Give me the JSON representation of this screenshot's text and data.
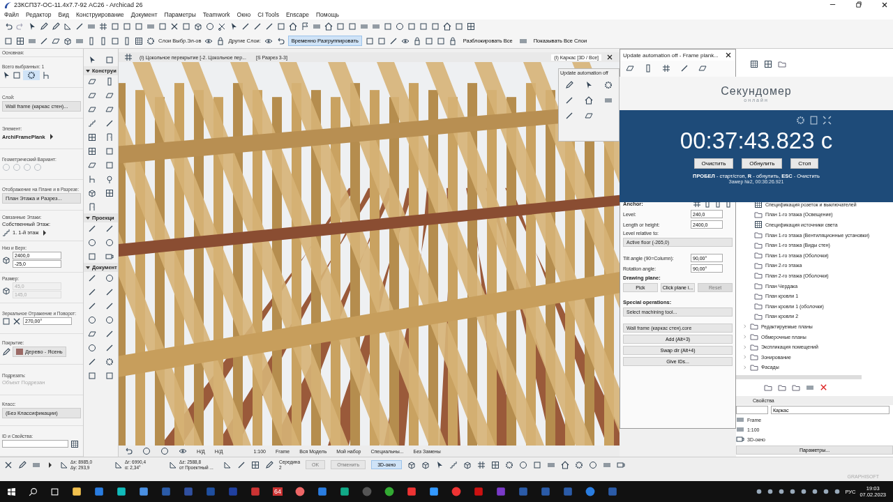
{
  "window": {
    "title": "23КСП37-ОС-11.4х7.7-92  AC26 - Archicad 26"
  },
  "menu": [
    "Файл",
    "Редактор",
    "Вид",
    "Конструирование",
    "Документ",
    "Параметры",
    "Teamwork",
    "Окно",
    "CI Tools",
    "Enscape",
    "Помощь"
  ],
  "toolbar": {
    "layer_labels": [
      "Слои Выбр.Эл-ов",
      "Другие Слои:"
    ],
    "buttons": [
      {
        "label": "Временно Разгруппировать",
        "selected": true
      },
      {
        "label": "Разблокировать Все",
        "selected": false
      },
      {
        "label": "Показывать Все Слои",
        "selected": false
      }
    ]
  },
  "info_panel": [
    {
      "kind": "header",
      "label": "Основная:"
    },
    {
      "kind": "selection",
      "label": "Всего выбранных: 1"
    },
    {
      "kind": "dropdown",
      "label": "Слой:",
      "value": "Wall frame (каркас стен)..."
    },
    {
      "kind": "element",
      "label": "Элемент:",
      "value": "ArchiFramePlank"
    },
    {
      "kind": "variants",
      "label": "Геометрический Вариант:"
    },
    {
      "kind": "dropdown",
      "label": "Отображение на Плане и в Разрезе:",
      "value": "План Этажа и Разрез..."
    },
    {
      "kind": "story",
      "label": "Связанные Этажи:",
      "title": "Собственный Этаж:",
      "value": "1. 1-й этаж"
    },
    {
      "kind": "pair",
      "label": "Низ и Верх:",
      "values": [
        "2400,0",
        "-25,0"
      ],
      "disabled": false
    },
    {
      "kind": "pair",
      "label": "Размер:",
      "values": [
        "45,0",
        "145,0"
      ],
      "disabled": true
    },
    {
      "kind": "angle",
      "label": "Зеркальное Отражение и Поворот:",
      "value": "270,00°"
    },
    {
      "kind": "surface",
      "label": "Покрытие:",
      "value": "Дерево - Ясень"
    },
    {
      "kind": "toggle",
      "label": "Подрезать:",
      "value": "Объект Подрезан",
      "disabled": true
    },
    {
      "kind": "dropdown",
      "label": "Класс:",
      "value": "(Без Классификации)"
    },
    {
      "kind": "field",
      "label": "ID и Свойства:"
    }
  ],
  "toolbox": [
    {
      "label": "Конструи",
      "expanded": true
    },
    {
      "label": "Проекци",
      "expanded": true
    },
    {
      "label": "Документ",
      "expanded": true
    }
  ],
  "view_tabs": [
    {
      "label": "(I) Цокольное перекрытие [-2. Цокольное пер...",
      "selected": false
    },
    {
      "label": "[S Разрез 3-3]",
      "selected": false
    },
    {
      "label": "(I) Каркас [3D / Все]",
      "selected": true
    }
  ],
  "view_bar": [
    "Н/Д",
    "Н/Д",
    "1:100",
    "Frame",
    "Вся Модель",
    "Мой набор",
    "Специальны...",
    "Без Замены"
  ],
  "mini_palette": {
    "title": "Update automation off"
  },
  "frame_palette": {
    "title": "Update automation off - Frame plank...",
    "anchor_label": "Anchor:",
    "fields": [
      {
        "label": "Level:",
        "value": "240,0"
      },
      {
        "label": "Length or height:",
        "value": "2400,0"
      }
    ],
    "level_relative": {
      "label": "Level relative to:",
      "value": "Active floor (-265,0)"
    },
    "angles": [
      {
        "label": "Tilt angle (90=Column):",
        "value": "90,00°"
      },
      {
        "label": "Rotation angle:",
        "value": "90,00°"
      }
    ],
    "drawing_plane": {
      "label": "Drawing plane:",
      "buttons": [
        {
          "label": "Pick",
          "disabled": false
        },
        {
          "label": "Click plane i...",
          "disabled": false
        },
        {
          "label": "Reset",
          "disabled": true
        }
      ]
    },
    "special": {
      "label": "Special operations:",
      "value": "Select machining tool..."
    },
    "layer": "Wall frame (каркас стен).core",
    "actions": [
      "Add (Alt+3)",
      "Swap dir (Alt+4)",
      "Give IDs..."
    ]
  },
  "stopwatch": {
    "title": "Секундомер",
    "subtitle": "онлайн",
    "time": "00:37:43.823 с",
    "buttons": [
      "Очистить",
      "Обнулить",
      "Стоп"
    ],
    "hint": "**ПРОБЕЛ** - старт/стоп, **R** - обнулить, **ESC** - Очистить",
    "lap": "Замер №2, 00:36:26.921"
  },
  "navigator": {
    "items": [
      {
        "kind": "schedule",
        "label": "Спецификация розеток и выключателей"
      },
      {
        "kind": "view",
        "label": "План 1-го этажа (Освещение)"
      },
      {
        "kind": "schedule",
        "label": "Спецификация источники света"
      },
      {
        "kind": "view",
        "label": "План 1-го этажа (Вентиляционные установки)"
      },
      {
        "kind": "view",
        "label": "План 1-го этажа (Виды стен)"
      },
      {
        "kind": "view",
        "label": "План 1-го этажа (Оболочки)"
      },
      {
        "kind": "view",
        "label": "План 2-го этажа"
      },
      {
        "kind": "view",
        "label": "План 2-го этажа (Оболочки)"
      },
      {
        "kind": "view",
        "label": "План Чердака"
      },
      {
        "kind": "view",
        "label": "План кровли 1"
      },
      {
        "kind": "view",
        "label": "План кровли 1 (оболочки)"
      },
      {
        "kind": "view",
        "label": "План кровли 2"
      },
      {
        "kind": "folder",
        "label": "Редактируемые планы"
      },
      {
        "kind": "folder",
        "label": "Обмерочные планы"
      },
      {
        "kind": "folder",
        "label": "Экспликация помещений"
      },
      {
        "kind": "folder",
        "label": "Зонирование"
      },
      {
        "kind": "folder",
        "label": "Фасады"
      }
    ],
    "properties_title": "Свойства",
    "name_value": "Каркас",
    "rows": [
      "Frame",
      "1:100",
      "3D-окно"
    ],
    "settings_button": "Параметры..."
  },
  "info_bar": {
    "coords": [
      [
        "Δx: 8985,0",
        "Δy: 293,9"
      ],
      [
        "Δr: 6990,4",
        "α: 2,34°"
      ],
      [
        "Δz: 2588,8",
        "от Проектный ..."
      ]
    ],
    "snap": [
      "Середина",
      "2"
    ],
    "ok": "OK",
    "cancel": "Отменить",
    "view_button": {
      "label": "3D-окно",
      "selected": true
    }
  },
  "brand": "GRAPHISOFT",
  "taskbar": {
    "badge": "64",
    "language": "РУС",
    "time": "19:03",
    "date": "07.02.2023"
  }
}
